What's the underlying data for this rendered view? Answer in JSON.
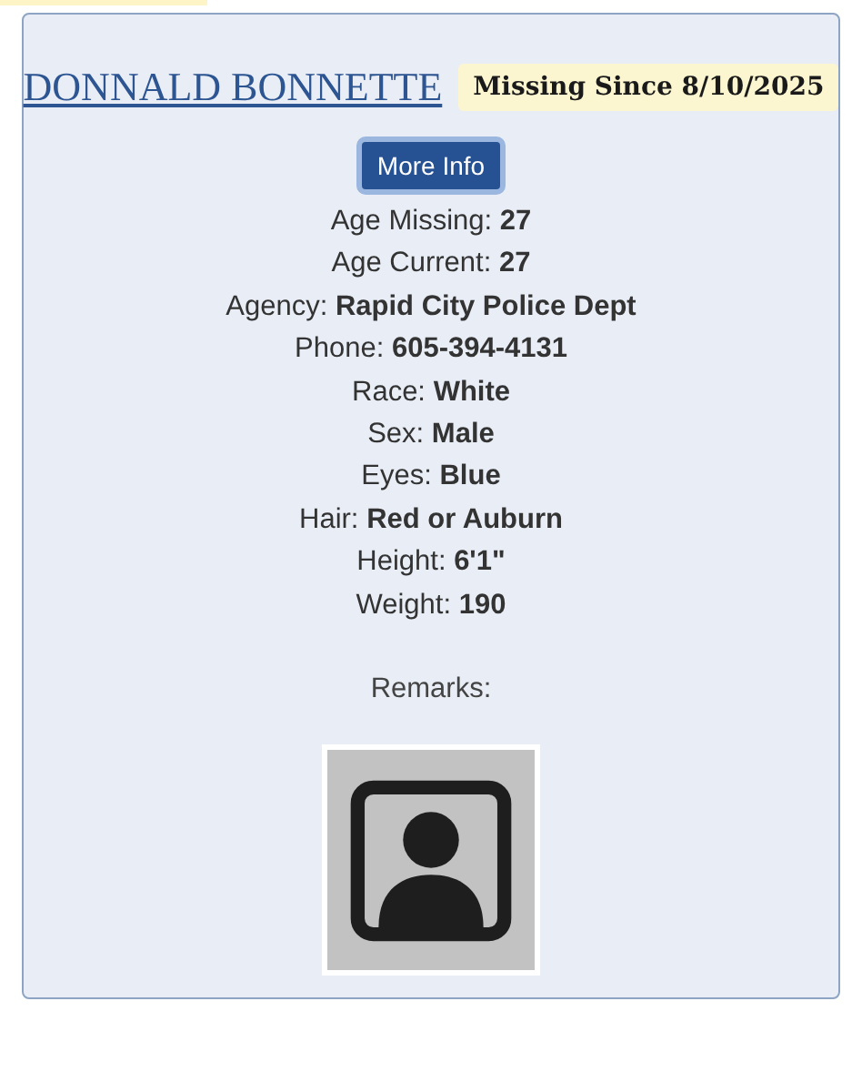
{
  "person": {
    "name": "DONNALD BONNETTE",
    "missing_since": "Missing Since 8/10/2025",
    "button": "More Info",
    "details": [
      {
        "label": "Age Missing:",
        "value": "27"
      },
      {
        "label": "Age Current:",
        "value": "27"
      },
      {
        "label": "Agency:",
        "value": "Rapid City Police Dept"
      },
      {
        "label": "Phone:",
        "value": "605-394-4131"
      },
      {
        "label": "Race:",
        "value": "White"
      },
      {
        "label": "Sex:",
        "value": "Male"
      },
      {
        "label": "Eyes:",
        "value": "Blue"
      },
      {
        "label": "Hair:",
        "value": "Red or Auburn"
      },
      {
        "label": "Height:",
        "value": "6'1\""
      },
      {
        "label": "Weight:",
        "value": "190"
      }
    ],
    "remarks": "Remarks:"
  }
}
